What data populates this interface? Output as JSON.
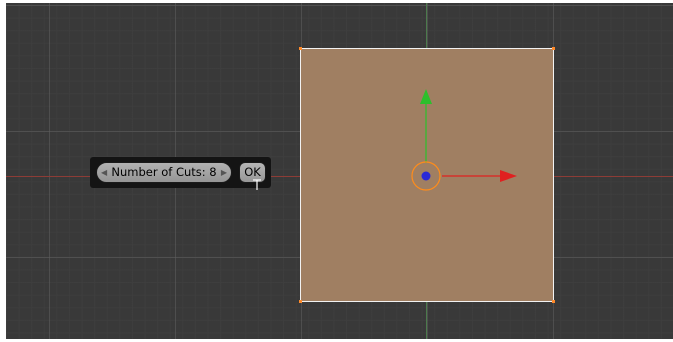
{
  "redo_panel": {
    "field_label": "Number of Cuts: 8",
    "field_value": 8,
    "decrement_glyph": "◀",
    "increment_glyph": "▶",
    "ok_label": "OK"
  },
  "viewport": {
    "mesh": "plane",
    "mesh_face_color": "#a07f62",
    "mesh_edge_color": "#f2f2f2",
    "vertex_color": "#ff8a2a",
    "x_axis_color": "#8d3c36",
    "y_axis_color": "#4c7a4c",
    "grid": true
  },
  "transform_gizmo": {
    "x_arrow_color": "#e02020",
    "y_arrow_color": "#2cc02c",
    "center_color": "#2a2ad8",
    "ring_color": "#ff8c1a",
    "icons": [
      "x-axis-arrow-icon",
      "y-axis-arrow-icon",
      "pivot-center-icon"
    ]
  }
}
